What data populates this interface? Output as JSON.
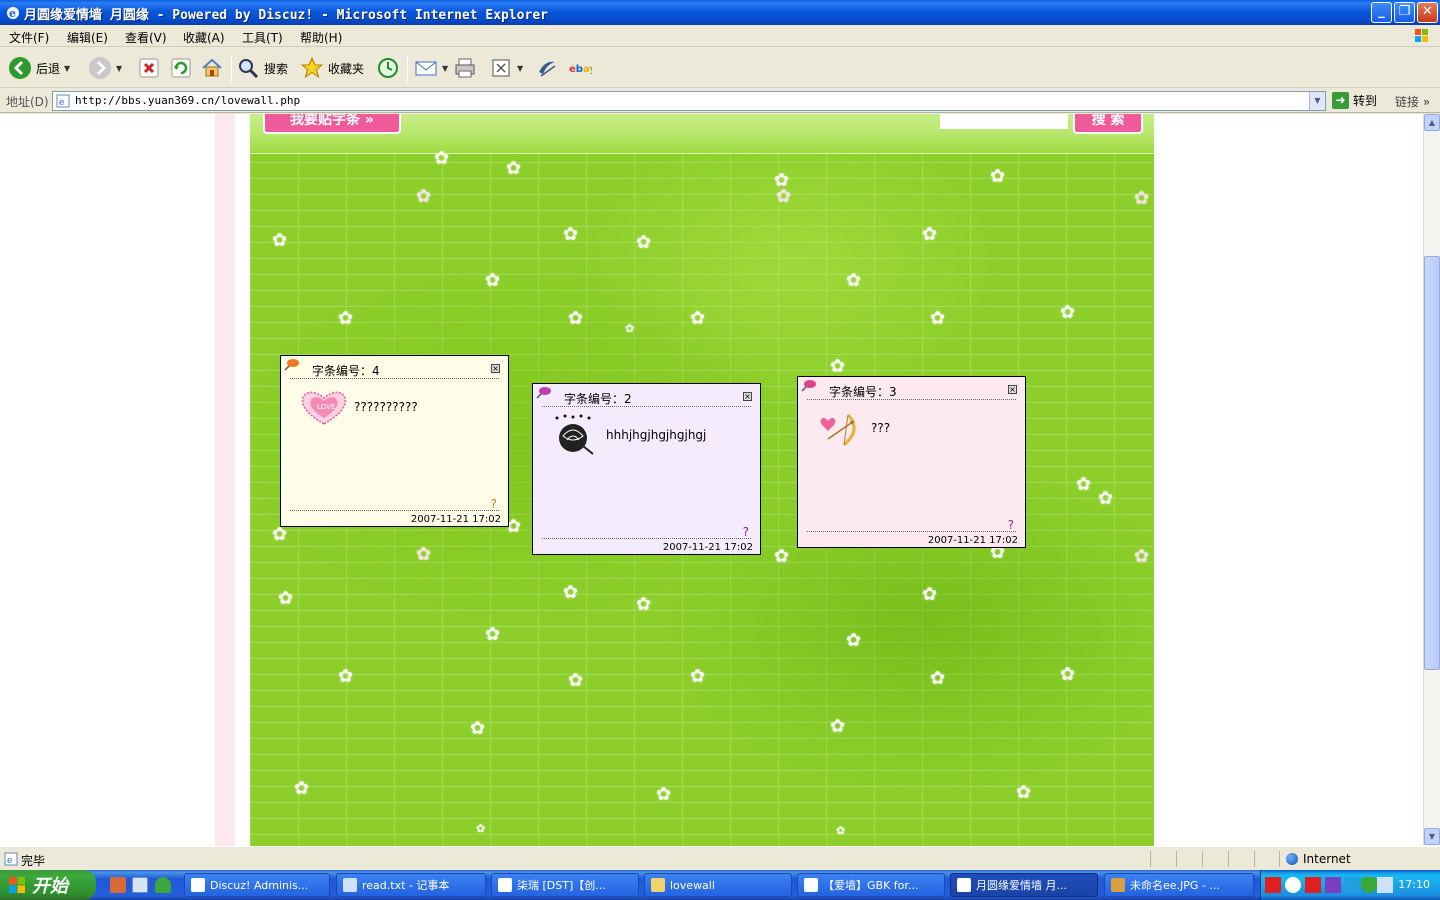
{
  "window": {
    "title": "月圆缘爱情墙 月圆缘 - Powered by Discuz! - Microsoft Internet Explorer",
    "minimize": "_",
    "restore": "❐",
    "close": "✕"
  },
  "menu": [
    "文件(F)",
    "编辑(E)",
    "查看(V)",
    "收藏(A)",
    "工具(T)",
    "帮助(H)"
  ],
  "toolbar": {
    "back_label": "后退",
    "search_label": "搜索",
    "favorites_label": "收藏夹"
  },
  "address": {
    "label": "地址(D)",
    "url": "http://bbs.yuan369.cn/lovewall.php",
    "go_label": "转到",
    "links_label": "链接 »"
  },
  "wall": {
    "write_button": "我要贴字条 »",
    "search_button": "搜 索"
  },
  "notes": [
    {
      "title": "字条编号：4",
      "message": "??????????",
      "qmark": "?",
      "date": "2007-11-21 17:02",
      "bg_color": "#fefde8",
      "qmark_color": "#d08000",
      "pin_color": "#f07820"
    },
    {
      "title": "字条编号：2",
      "message": "hhhjhgjhgjhgjhgj",
      "qmark": "?",
      "date": "2007-11-21 17:02",
      "bg_color": "#f4ecfc",
      "qmark_color": "#7a2aa8",
      "pin_color": "#c040b0"
    },
    {
      "title": "字条编号：3",
      "message": "???",
      "qmark": "?",
      "date": "2007-11-21 17:02",
      "bg_color": "#fdeaf1",
      "qmark_color": "#c0207a",
      "pin_color": "#e04090"
    }
  ],
  "status": {
    "text": "完毕",
    "zone": "Internet"
  },
  "taskbar": {
    "start_label": "开始",
    "tasks": [
      "Discuz! Adminis...",
      "read.txt - 记事本",
      "柒瑞 [DST]【创...",
      "lovewall",
      "【爱墙】GBK for...",
      "月圆缘爱情墙 月...",
      "未命名ee.JPG - ..."
    ],
    "active_task": 5,
    "clock": "17:10"
  }
}
